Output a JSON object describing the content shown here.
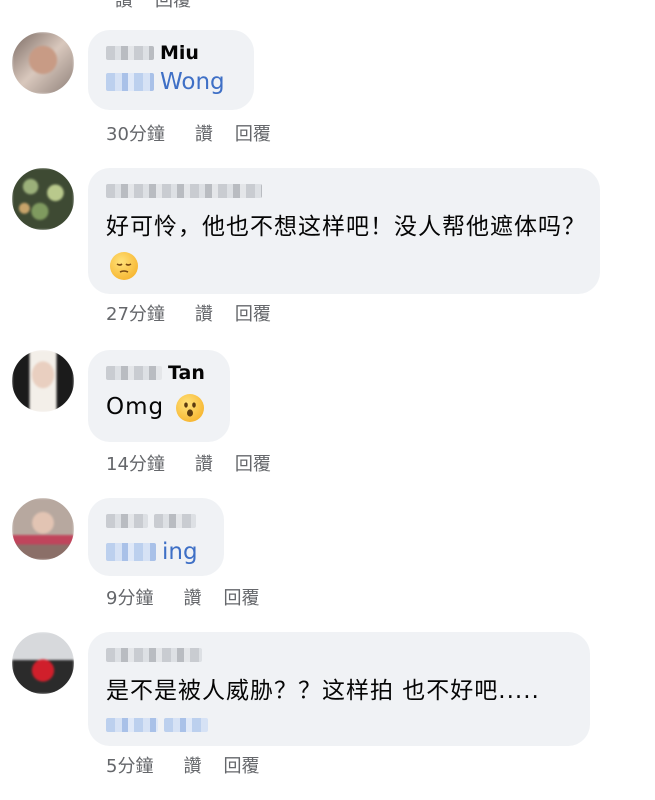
{
  "top_meta": {
    "like": "讚",
    "reply": "回覆"
  },
  "comments": [
    {
      "name": "Miu",
      "tag": "Wong",
      "text": "",
      "time": "30分鐘",
      "like": "讚",
      "reply": "回覆"
    },
    {
      "name": "",
      "tag": "",
      "text": "好可怜，他也不想这样吧！没人帮他遮体吗？",
      "emoji": "pensive-face-icon",
      "time": "27分鐘",
      "like": "讚",
      "reply": "回覆"
    },
    {
      "name": "Tan",
      "tag": "",
      "text": "Omg",
      "emoji": "astonished-face-icon",
      "time": "14分鐘",
      "like": "讚",
      "reply": "回覆"
    },
    {
      "name": "",
      "tag": "ing",
      "text": "",
      "time": "9分鐘",
      "like": "讚",
      "reply": "回覆"
    },
    {
      "name": "",
      "tag": "",
      "text": "是不是被人威胁？？这样拍 也不好吧.....",
      "time": "5分鐘",
      "like": "讚",
      "reply": "回覆"
    }
  ],
  "colors": {
    "bubble": "#f0f2f5",
    "tag_blue": "#3f70c6",
    "meta_gray": "#65676b"
  }
}
